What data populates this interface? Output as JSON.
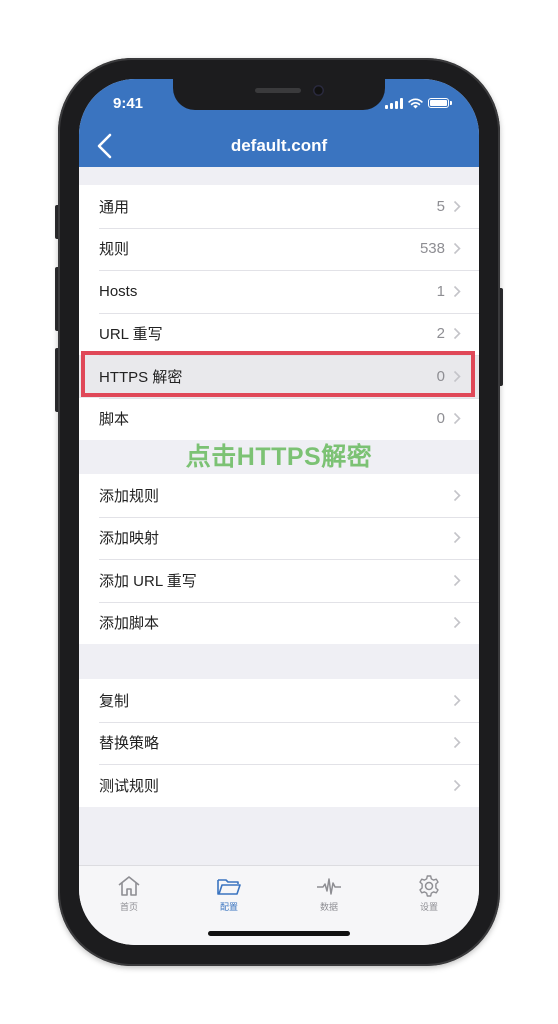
{
  "status_bar": {
    "time": "9:41"
  },
  "nav": {
    "title": "default.conf"
  },
  "group1": [
    {
      "label": "通用",
      "value": "5"
    },
    {
      "label": "规则",
      "value": "538"
    },
    {
      "label": "Hosts",
      "value": "1"
    },
    {
      "label": "URL 重写",
      "value": "2"
    },
    {
      "label": "HTTPS 解密",
      "value": "0"
    },
    {
      "label": "脚本",
      "value": "0"
    }
  ],
  "annotation": {
    "text": "点击HTTPS解密",
    "color": "#7cc274",
    "box_color": "#e04858"
  },
  "group2": [
    {
      "label": "添加规则"
    },
    {
      "label": "添加映射"
    },
    {
      "label": "添加 URL 重写"
    },
    {
      "label": "添加脚本"
    }
  ],
  "group3": [
    {
      "label": "复制"
    },
    {
      "label": "替换策略"
    },
    {
      "label": "测试规则"
    }
  ],
  "tabs": [
    {
      "label": "首页",
      "icon": "home-icon"
    },
    {
      "label": "配置",
      "icon": "folder-icon",
      "active": true
    },
    {
      "label": "数据",
      "icon": "waveform-icon"
    },
    {
      "label": "设置",
      "icon": "gear-icon"
    }
  ],
  "colors": {
    "accent": "#3a74c0",
    "background": "#efeff4"
  }
}
